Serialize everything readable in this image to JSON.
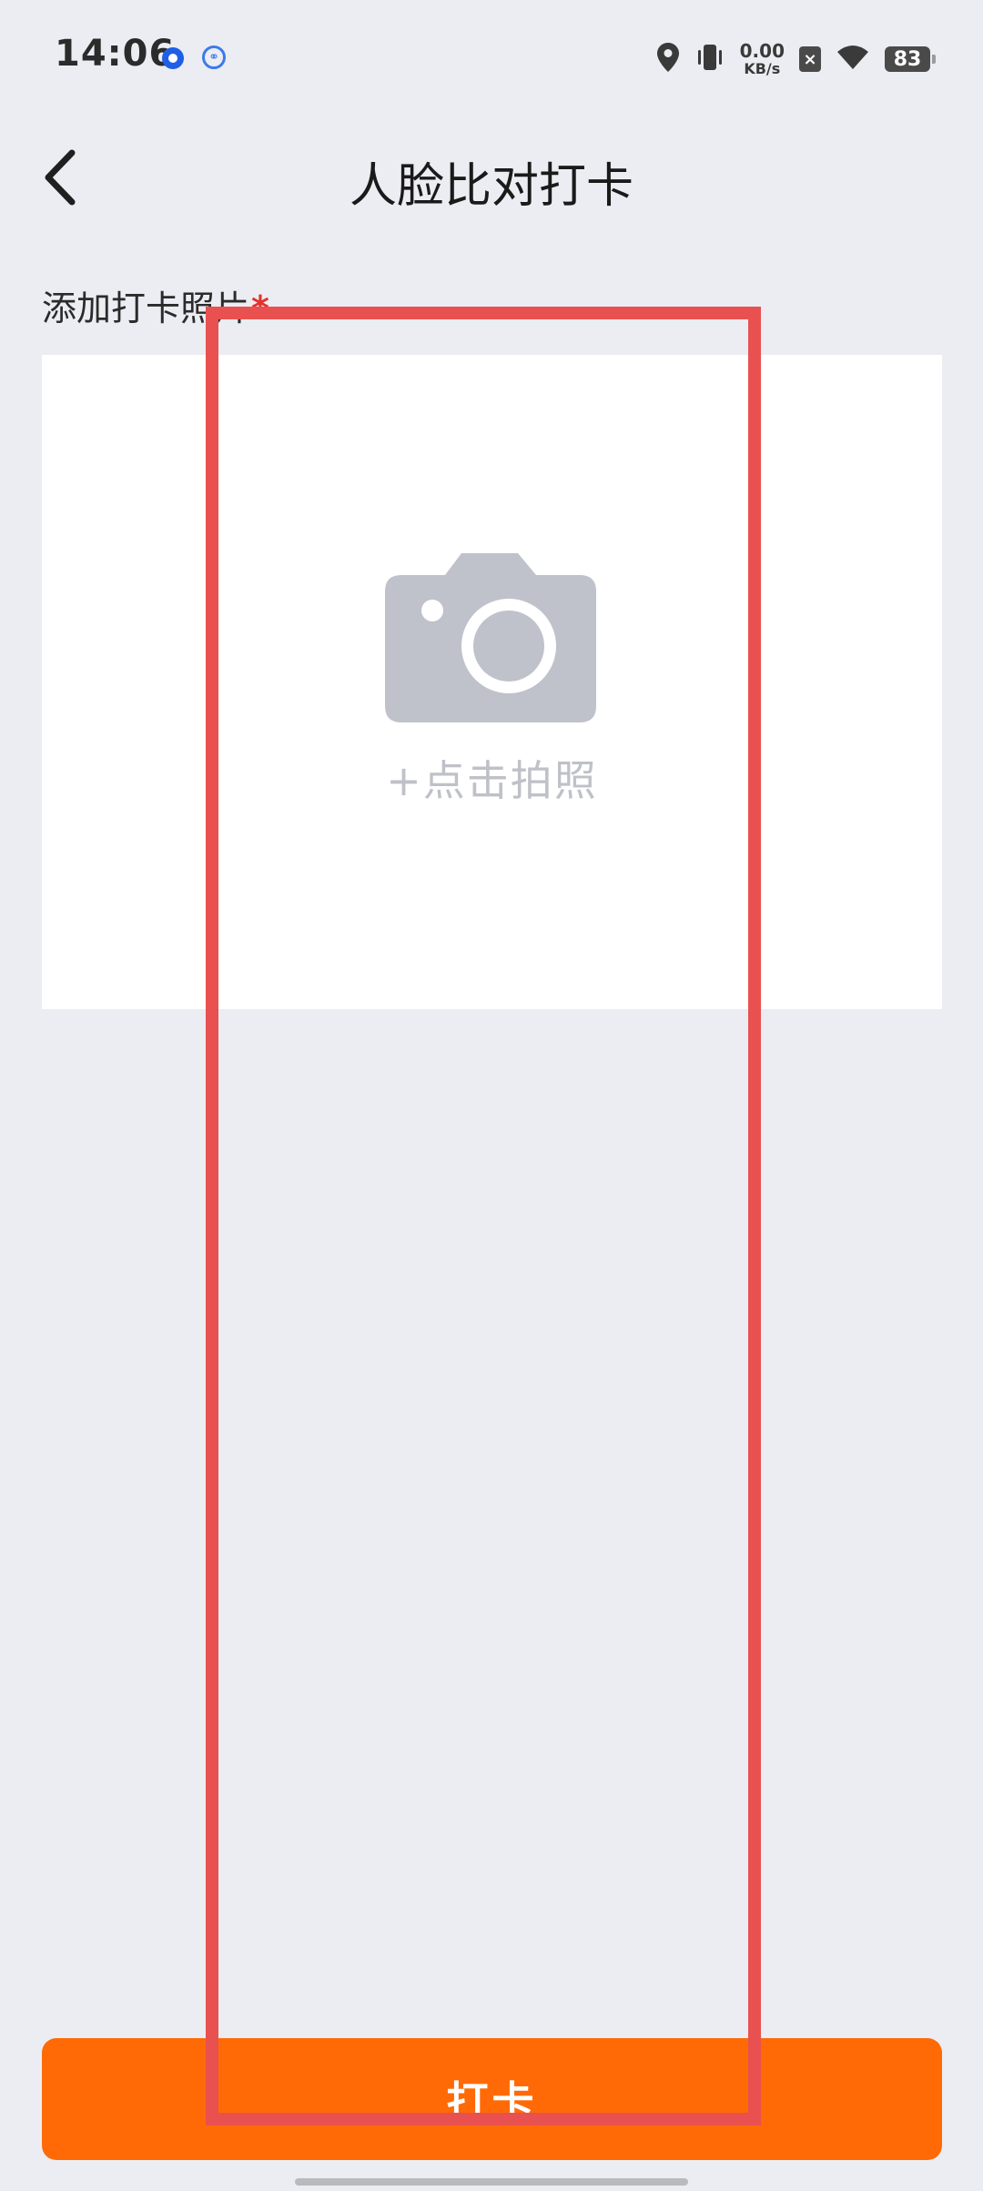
{
  "status_bar": {
    "time": "14:06",
    "net_speed_value": "0.00",
    "net_speed_unit": "KB/s",
    "battery_level": "83",
    "sim_status": "×"
  },
  "header": {
    "title": "人脸比对打卡"
  },
  "photo_section": {
    "label": "添加打卡照片",
    "required_mark": "*",
    "take_photo_label": "+点击拍照"
  },
  "actions": {
    "checkin_label": "打卡"
  },
  "colors": {
    "background": "#ECEDF2",
    "accent": "#FF6A06",
    "annotation": "#e8514f",
    "placeholder": "#bfc1c8"
  }
}
